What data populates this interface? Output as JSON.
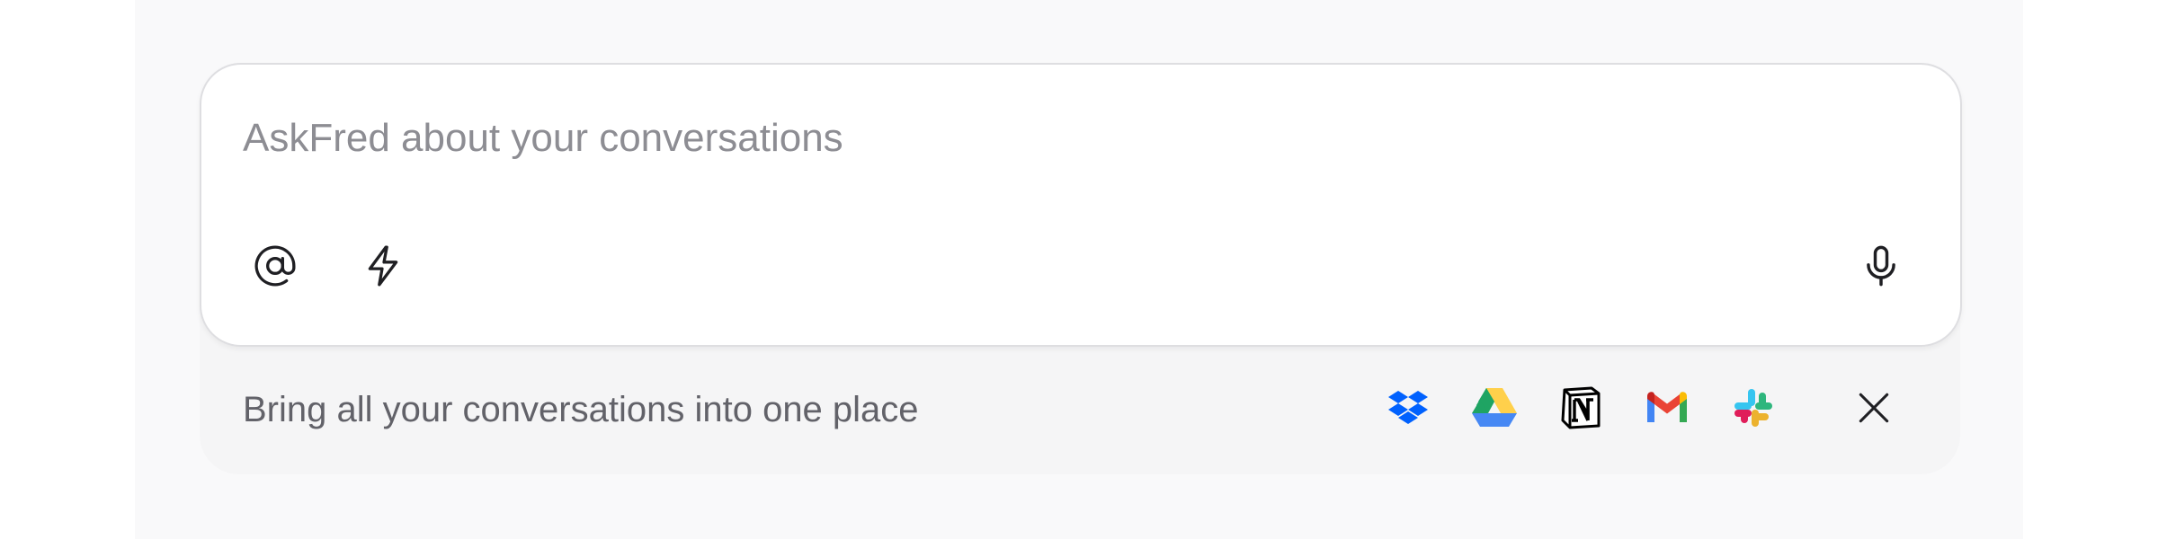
{
  "prompt": {
    "placeholder": "AskFred about your conversations",
    "value": ""
  },
  "toolbar": {
    "mention_icon": "at-sign-icon",
    "shortcut_icon": "lightning-bolt-icon",
    "voice_icon": "microphone-icon"
  },
  "integrations": {
    "message": "Bring all your conversations into one place",
    "apps": [
      {
        "name": "Dropbox",
        "icon": "dropbox-icon",
        "color": "#0061fe"
      },
      {
        "name": "Google Drive",
        "icon": "google-drive-icon",
        "colors": [
          "#1fa463",
          "#ffd04b",
          "#4688f4"
        ]
      },
      {
        "name": "Notion",
        "icon": "notion-icon",
        "color": "#000000"
      },
      {
        "name": "Gmail",
        "icon": "gmail-icon",
        "colors": [
          "#ea4335",
          "#4285f4",
          "#34a853",
          "#fbbc04"
        ]
      },
      {
        "name": "Slack",
        "icon": "slack-icon",
        "colors": [
          "#36c5f0",
          "#2eb67d",
          "#ecb22e",
          "#e01e5a"
        ]
      }
    ],
    "dismiss_icon": "close-icon"
  },
  "colors": {
    "placeholder_text": "#8d8d93",
    "secondary_text": "#626269",
    "icon_stroke": "#1f1f23",
    "card_border": "#dedee1",
    "panel_background": "#f5f5f6",
    "page_background": "#f9f9fa"
  }
}
